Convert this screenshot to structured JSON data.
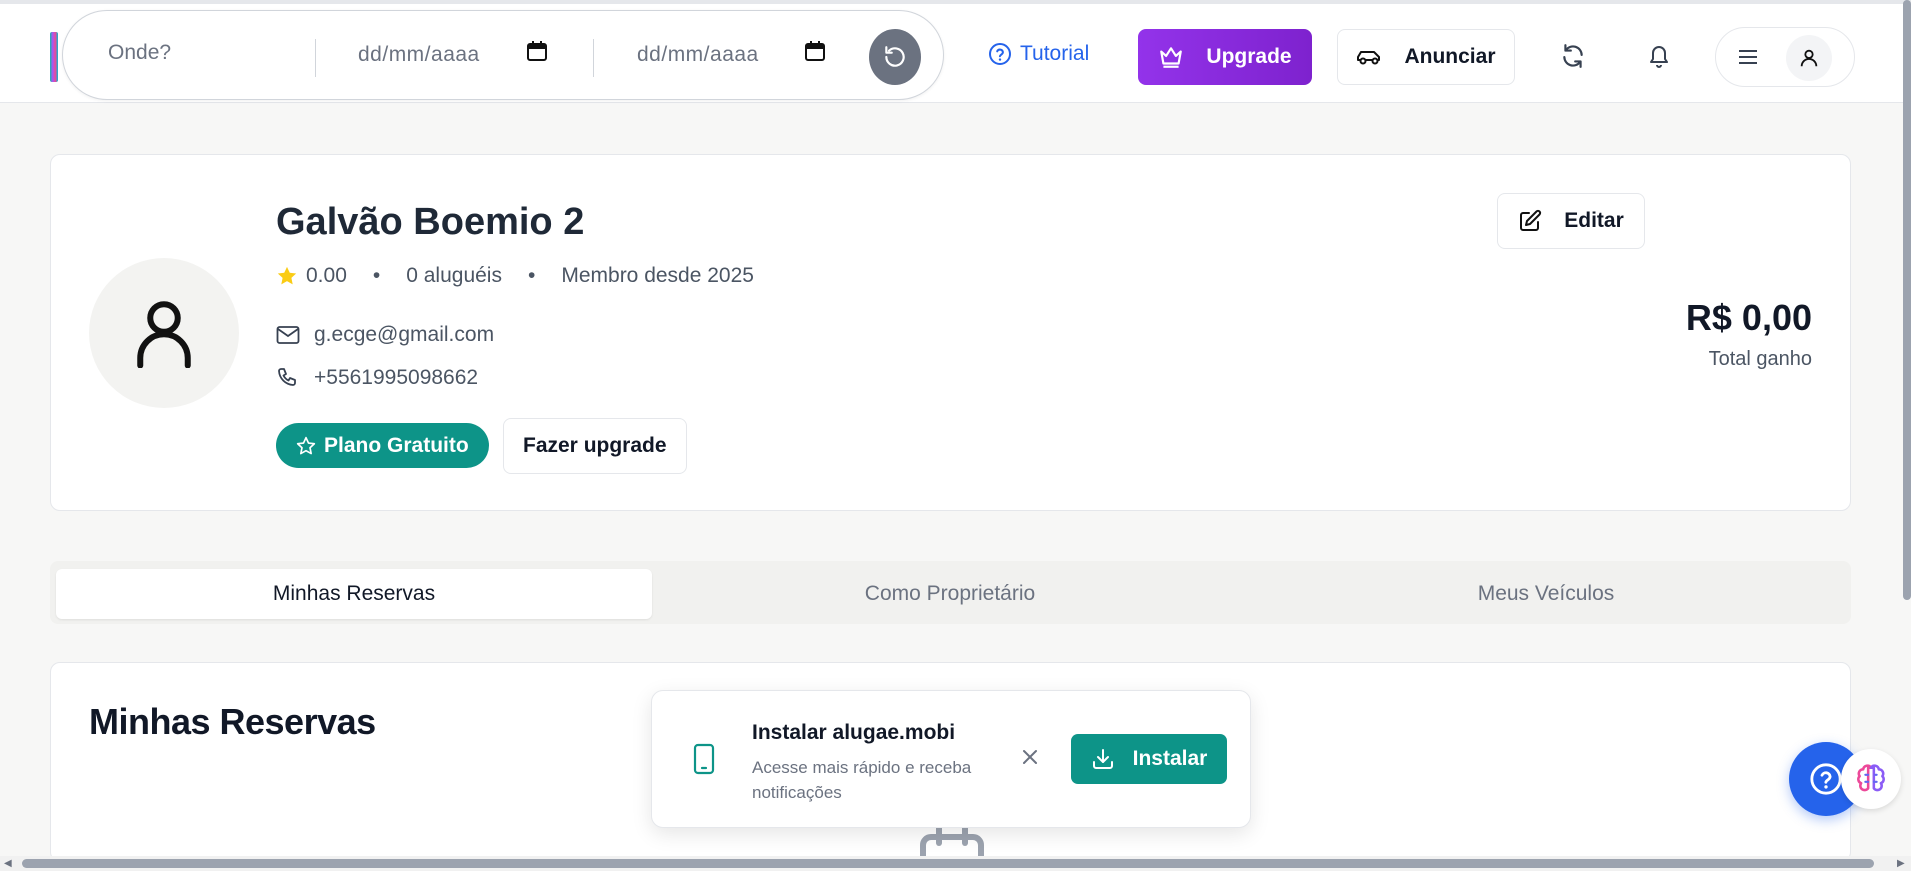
{
  "header": {
    "search": {
      "where_placeholder": "Onde?",
      "start_date_placeholder": "dd/mm/aaaa",
      "end_date_placeholder": "dd/mm/aaaa"
    },
    "tutorial_label": "Tutorial",
    "upgrade_label": "Upgrade",
    "anunciar_label": "Anunciar",
    "icons": [
      "calendar-icon",
      "reset-icon",
      "help-circle-icon",
      "crown-icon",
      "car-icon",
      "refresh-icon",
      "bell-icon",
      "menu-icon",
      "user-icon"
    ]
  },
  "profile": {
    "name": "Galvão Boemio 2",
    "rating": "0.00",
    "dot": "•",
    "rentals": "0 aluguéis",
    "member_since": "Membro desde 2025",
    "email": "g.ecge@gmail.com",
    "phone": "+5561995098662",
    "plan_label": "Plano Gratuito",
    "upgrade_button": "Fazer upgrade",
    "edit_button": "Editar",
    "total_earned_amount": "R$ 0,00",
    "total_earned_label": "Total ganho"
  },
  "tabs": [
    {
      "label": "Minhas Reservas",
      "active": true
    },
    {
      "label": "Como Proprietário",
      "active": false
    },
    {
      "label": "Meus Veículos",
      "active": false
    }
  ],
  "reservations": {
    "title": "Minhas Reservas"
  },
  "install_toast": {
    "title": "Instalar alugae.mobi",
    "subtitle": "Acesse mais rápido e receba notificações",
    "install_label": "Instalar"
  },
  "colors": {
    "accent_teal": "#0d9488",
    "upgrade_purple": "#9333ea",
    "link_blue": "#2563eb",
    "star_yellow": "#facc15"
  }
}
